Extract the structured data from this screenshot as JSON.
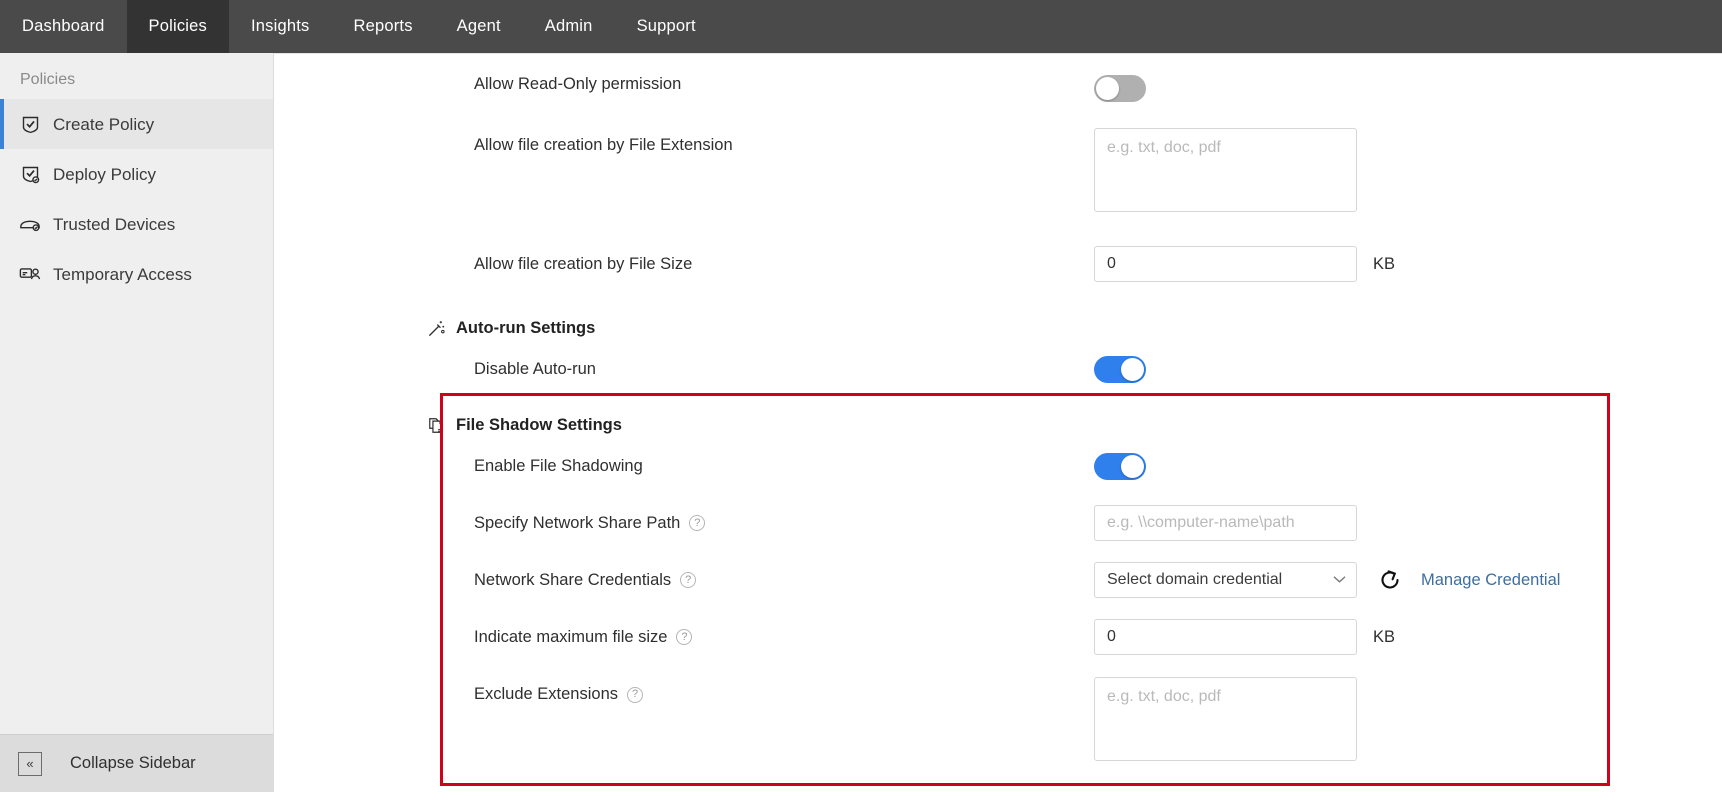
{
  "topnav": {
    "items": [
      {
        "label": "Dashboard",
        "active": false
      },
      {
        "label": "Policies",
        "active": true
      },
      {
        "label": "Insights",
        "active": false
      },
      {
        "label": "Reports",
        "active": false
      },
      {
        "label": "Agent",
        "active": false
      },
      {
        "label": "Admin",
        "active": false
      },
      {
        "label": "Support",
        "active": false
      }
    ],
    "active_bg": "#333333",
    "bg": "#4a4a4a"
  },
  "sidebar": {
    "title": "Policies",
    "items": [
      {
        "label": "Create Policy",
        "icon": "shield-check-icon",
        "active": true
      },
      {
        "label": "Deploy Policy",
        "icon": "deploy-policy-icon",
        "active": false
      },
      {
        "label": "Trusted Devices",
        "icon": "trusted-device-icon",
        "active": false
      },
      {
        "label": "Temporary Access",
        "icon": "temporary-access-icon",
        "active": false
      }
    ],
    "collapse": {
      "label": "Collapse Sidebar",
      "glyph": "«"
    },
    "accent": "#3b82d6"
  },
  "form": {
    "rows": [
      {
        "label": "Allow Read-Only permission",
        "control": "toggle",
        "state": "off"
      },
      {
        "label": "Allow file creation by File Extension",
        "control": "textarea",
        "value": "",
        "placeholder": "e.g. txt, doc, pdf"
      },
      {
        "label": "Allow file creation by File Size",
        "control": "input-unit",
        "value": "0",
        "unit": "KB"
      }
    ],
    "autorun_section": {
      "title": "Auto-run Settings",
      "icon": "magic-wand-icon",
      "row": {
        "label": "Disable Auto-run",
        "control": "toggle",
        "state": "on"
      }
    },
    "file_shadow_section": {
      "title": "File Shadow Settings",
      "icon": "file-copy-icon",
      "highlight_color": "#d0021b",
      "rows": [
        {
          "label": "Enable File Shadowing",
          "control": "toggle",
          "state": "on",
          "help": false
        },
        {
          "label": "Specify Network Share Path",
          "control": "input",
          "value": "",
          "placeholder": "e.g. \\\\computer-name\\path",
          "help": true
        },
        {
          "label": "Network Share Credentials",
          "control": "select",
          "selected": "Select domain credential",
          "help": true,
          "refresh_icon": "refresh-icon",
          "link_label": "Manage Credential",
          "link_color": "#3f6e9e"
        },
        {
          "label": "Indicate maximum file size",
          "control": "input-unit",
          "value": "0",
          "unit": "KB",
          "help": true
        },
        {
          "label": "Exclude Extensions",
          "control": "textarea",
          "value": "",
          "placeholder": "e.g. txt, doc, pdf",
          "help": true
        }
      ]
    },
    "help_glyph": "?"
  }
}
